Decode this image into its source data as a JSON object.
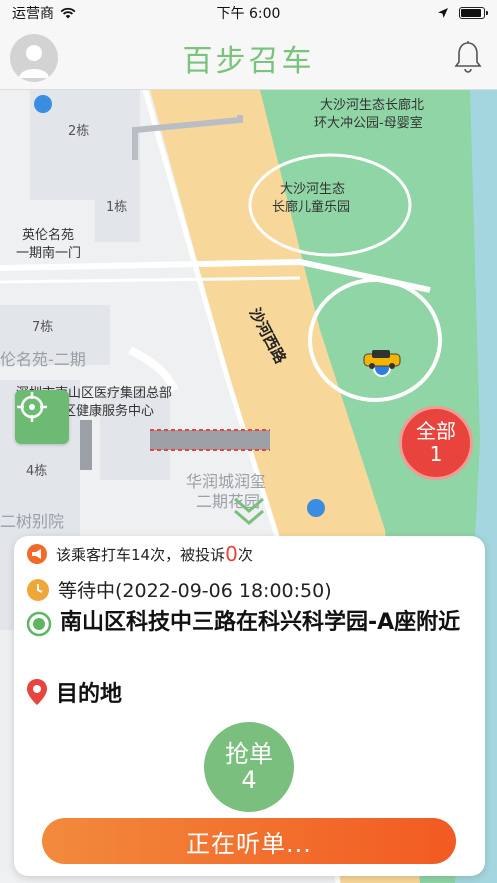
{
  "status_bar": {
    "carrier": "运营商",
    "time": "下午 6:00"
  },
  "navbar": {
    "title": "百步召车"
  },
  "map": {
    "labels": {
      "park_north": "大沙河生态长廊北",
      "park_north2": "环大冲公园-母婴室",
      "park_kids1": "大沙河生态",
      "park_kids2": "长廊儿童乐园",
      "road": "沙河西路",
      "bld2": "2栋",
      "bld1": "1栋",
      "yingluan1": "英伦名苑",
      "yingluan2": "一期南一门",
      "bld7": "7栋",
      "lunming": "伦名苑-二期",
      "hospital1": "深圳市南山区医疗集团总部",
      "hospital2": "社区健康服务中心",
      "bld4": "4栋",
      "huarun1": "华润城润玺",
      "huarun2": "二期花园",
      "shulin": "二树别院"
    },
    "all_button": {
      "label": "全部",
      "count": "1"
    }
  },
  "order_card": {
    "passenger_info_prefix": "该乘客打车14次，被投诉",
    "complaints": "0",
    "passenger_info_suffix": "次",
    "status": "等待中(2022-09-06 18:00:50)",
    "pickup": "南山区科技中三路在科兴科学园-A座附近",
    "destination": "目的地",
    "grab_label": "抢单",
    "grab_count": "4",
    "listen_label": "正在听单..."
  },
  "colors": {
    "brand_green": "#79c47b",
    "alert_red": "#e8433c",
    "orange": "#f26a2a"
  }
}
